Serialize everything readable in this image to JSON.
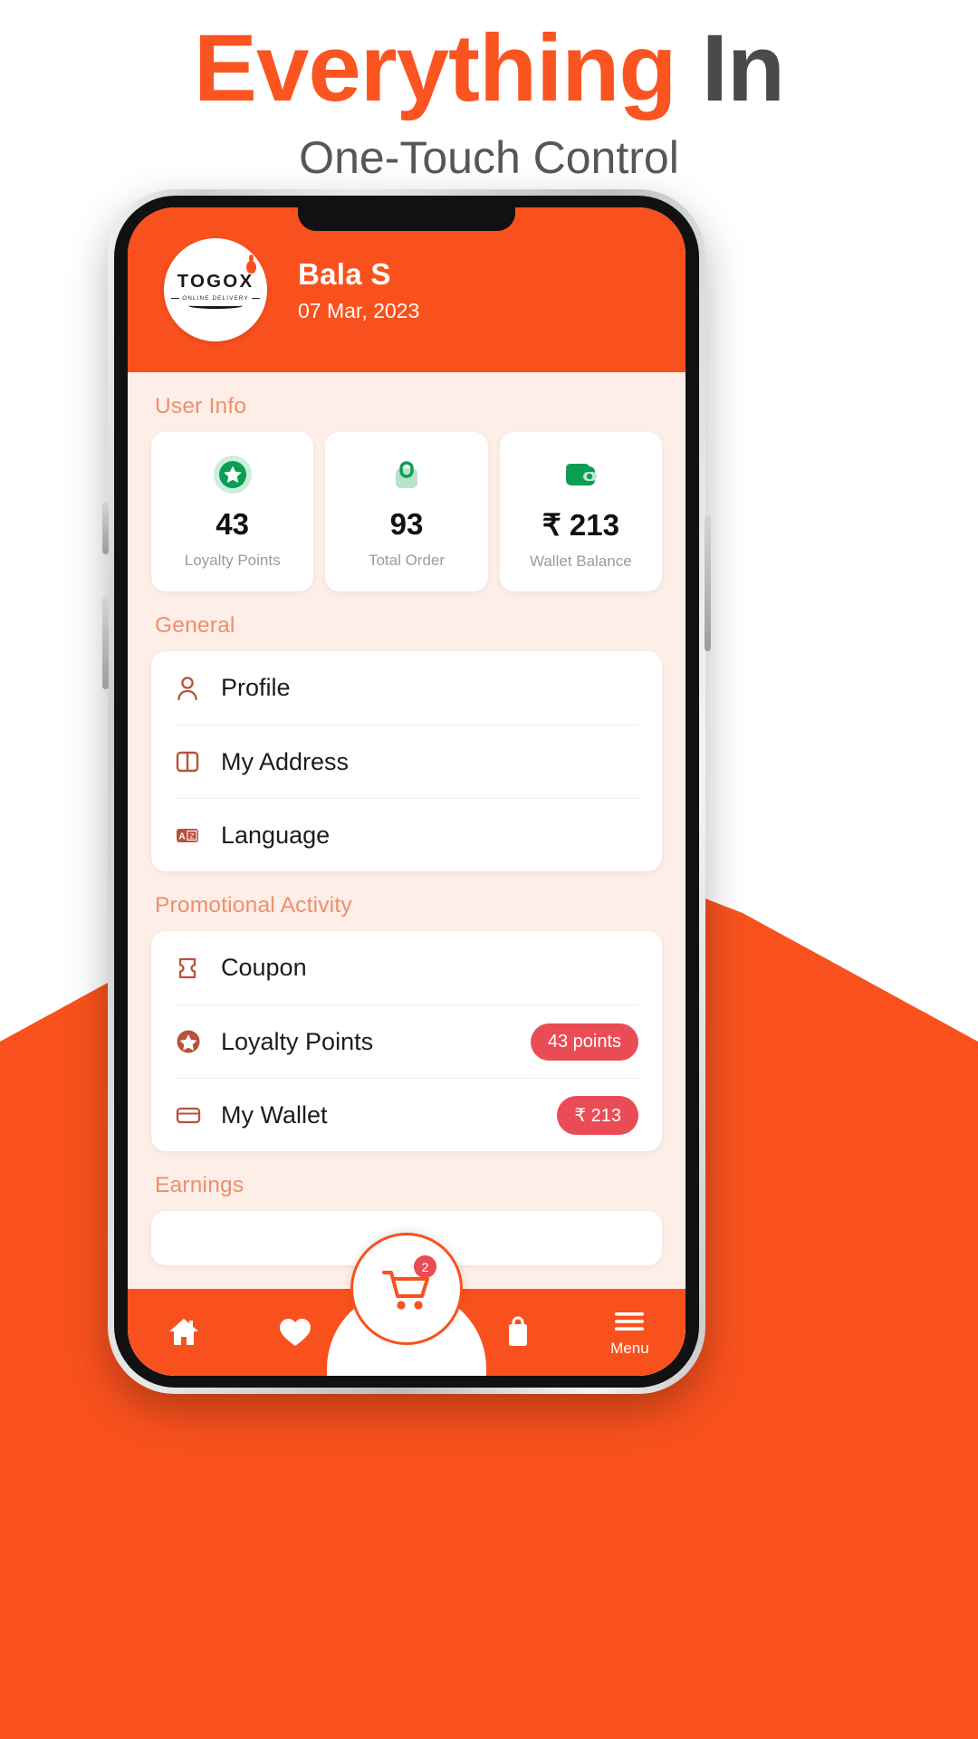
{
  "headline": {
    "line1_accent": "Everything",
    "line1_rest": "In",
    "line2": "One-Touch Control",
    "accent_color": "#fa5421",
    "dark_color": "#4a4a4a"
  },
  "app": {
    "header": {
      "logo_word": "TOGOX",
      "logo_tagline": "ONLINE DELIVERY",
      "user_name": "Bala S",
      "date": "07 Mar, 2023",
      "bg_color": "#f9511d"
    },
    "sections": {
      "user_info_title": "User Info",
      "general_title": "General",
      "promotional_title": "Promotional Activity",
      "earnings_title": "Earnings"
    },
    "stats": [
      {
        "icon": "star-badge-icon",
        "value": "43",
        "label": "Loyalty Points"
      },
      {
        "icon": "shopping-bag-icon",
        "value": "93",
        "label": "Total Order"
      },
      {
        "icon": "wallet-icon",
        "value": "₹ 213",
        "label": "Wallet Balance"
      }
    ],
    "general_items": [
      {
        "icon": "user-icon",
        "label": "Profile"
      },
      {
        "icon": "address-book-icon",
        "label": "My Address"
      },
      {
        "icon": "language-icon",
        "label": "Language"
      }
    ],
    "promotional_items": [
      {
        "icon": "coupon-icon",
        "label": "Coupon",
        "badge": ""
      },
      {
        "icon": "star-circle-icon",
        "label": "Loyalty Points",
        "badge": "43 points"
      },
      {
        "icon": "card-icon",
        "label": "My Wallet",
        "badge": "₹ 213"
      }
    ],
    "bottom_nav": {
      "items": [
        {
          "icon": "home-icon",
          "label": ""
        },
        {
          "icon": "heart-icon",
          "label": ""
        },
        {
          "icon": "cart-icon",
          "label": ""
        },
        {
          "icon": "bag-icon",
          "label": ""
        },
        {
          "icon": "hamburger-menu-icon",
          "label": "Menu"
        }
      ],
      "cart_badge": "2",
      "badge_color": "#ea4c55"
    }
  }
}
